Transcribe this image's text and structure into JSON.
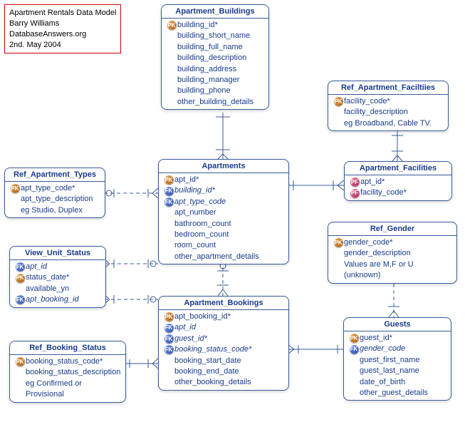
{
  "info": {
    "title": "Apartment Rentals Data Model",
    "author": "Barry Williams",
    "source": "DatabaseAnswers.org",
    "date": "2nd. May 2004"
  },
  "entities": {
    "apartment_buildings": {
      "title": "Apartment_Buildings",
      "fields": [
        {
          "key": "PK",
          "name": "building_id",
          "req": true
        },
        {
          "key": "",
          "name": "building_short_name"
        },
        {
          "key": "",
          "name": "building_full_name"
        },
        {
          "key": "",
          "name": "building_description"
        },
        {
          "key": "",
          "name": "building_address"
        },
        {
          "key": "",
          "name": "building_manager"
        },
        {
          "key": "",
          "name": "building_phone"
        },
        {
          "key": "",
          "name": "other_building_details"
        }
      ]
    },
    "ref_apartment_facilities": {
      "title": "Ref_Apartment_Faciltiies",
      "fields": [
        {
          "key": "PK",
          "name": "facility_code",
          "req": true
        },
        {
          "key": "",
          "name": "facility_description"
        },
        {
          "key": "",
          "name": "eg Broadband, Cable TV."
        }
      ]
    },
    "ref_apartment_types": {
      "title": "Ref_Apartment_Types",
      "fields": [
        {
          "key": "PK",
          "name": "apt_type_code",
          "req": true
        },
        {
          "key": "",
          "name": "apt_type_description"
        },
        {
          "key": "",
          "name": "eg Studio, Duplex"
        }
      ]
    },
    "apartments": {
      "title": "Apartments",
      "fields": [
        {
          "key": "PK",
          "name": "apt_id",
          "req": true
        },
        {
          "key": "FK",
          "name": "building_id",
          "req": true,
          "italic": true
        },
        {
          "key": "FK",
          "name": "apt_type_code",
          "italic": true
        },
        {
          "key": "",
          "name": "apt_number"
        },
        {
          "key": "",
          "name": "bathroom_count"
        },
        {
          "key": "",
          "name": "bedroom_count"
        },
        {
          "key": "",
          "name": "room_count"
        },
        {
          "key": "",
          "name": "other_apartment_details"
        }
      ]
    },
    "apartment_facilities": {
      "title": "Apartment_Facilities",
      "fields": [
        {
          "key": "PF",
          "name": "apt_id",
          "req": true
        },
        {
          "key": "PF",
          "name": "facility_code",
          "req": true
        }
      ]
    },
    "ref_gender": {
      "title": "Ref_Gender",
      "fields": [
        {
          "key": "PK",
          "name": "gender_code",
          "req": true
        },
        {
          "key": "",
          "name": "gender_description"
        },
        {
          "key": "",
          "name": "Values are M,F or U (unknown)"
        }
      ]
    },
    "view_unit_status": {
      "title": "View_Unit_Status",
      "fields": [
        {
          "key": "FK",
          "name": "apt_id",
          "italic": true
        },
        {
          "key": "PK",
          "name": "status_date",
          "req": true
        },
        {
          "key": "",
          "name": "available_yn"
        },
        {
          "key": "FK",
          "name": "apt_booking_id",
          "italic": true
        }
      ]
    },
    "apartment_bookings": {
      "title": "Apartment_Bookings",
      "fields": [
        {
          "key": "PK",
          "name": "apt_booking_id",
          "req": true
        },
        {
          "key": "FK",
          "name": "apt_id",
          "italic": true
        },
        {
          "key": "FK",
          "name": "guest_id",
          "req": true,
          "italic": true
        },
        {
          "key": "FK",
          "name": "booking_status_code",
          "req": true,
          "italic": true
        },
        {
          "key": "",
          "name": "booking_start_date"
        },
        {
          "key": "",
          "name": "booking_end_date"
        },
        {
          "key": "",
          "name": "other_booking_details"
        }
      ]
    },
    "ref_booking_status": {
      "title": "Ref_Booking_Status",
      "fields": [
        {
          "key": "PK",
          "name": "booking_status_code",
          "req": true
        },
        {
          "key": "",
          "name": "booking_status_description"
        },
        {
          "key": "",
          "name": "eg Confirmed or Provisional"
        }
      ]
    },
    "guests": {
      "title": "Guests",
      "fields": [
        {
          "key": "PK",
          "name": "guest_id",
          "req": true
        },
        {
          "key": "FK",
          "name": "gender_code",
          "italic": true
        },
        {
          "key": "",
          "name": "guest_first_name"
        },
        {
          "key": "",
          "name": "guest_last_name"
        },
        {
          "key": "",
          "name": "date_of_birth"
        },
        {
          "key": "",
          "name": "other_guest_details"
        }
      ]
    }
  }
}
